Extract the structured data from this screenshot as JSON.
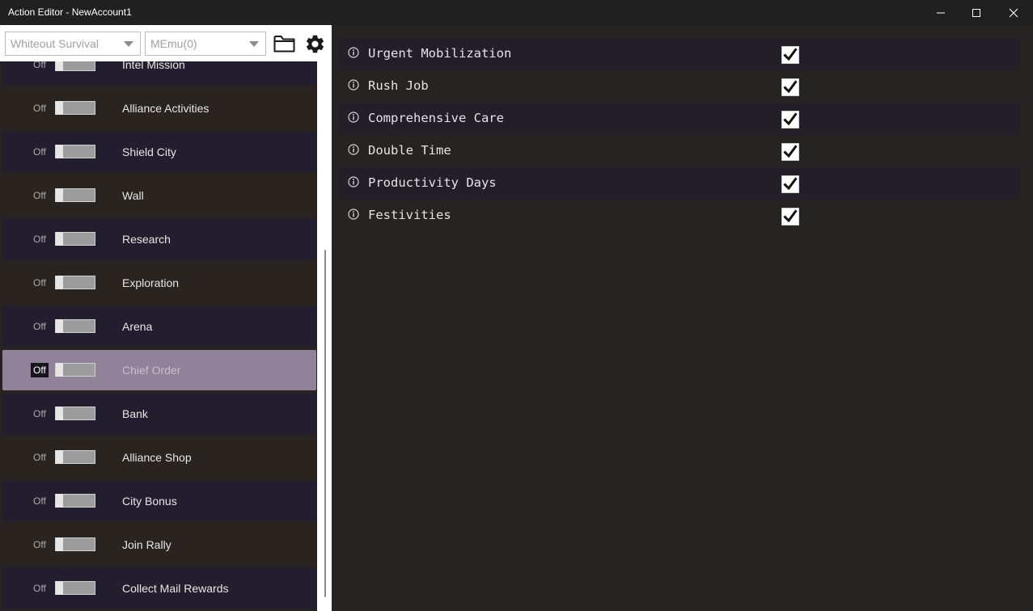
{
  "window": {
    "title": "Action Editor - NewAccount1",
    "controls": [
      "minimize-icon",
      "maximize-icon",
      "close-icon"
    ]
  },
  "toolbar": {
    "game_select": {
      "value": "Whiteout Survival"
    },
    "emulator_select": {
      "value": "MEmu(0)"
    },
    "icons": [
      "folder-icon",
      "gear-icon"
    ]
  },
  "actions": {
    "items": [
      {
        "label": "Intel Mission",
        "state": "Off",
        "selected": false
      },
      {
        "label": "Alliance Activities",
        "state": "Off",
        "selected": false
      },
      {
        "label": "Shield City",
        "state": "Off",
        "selected": false
      },
      {
        "label": "Wall",
        "state": "Off",
        "selected": false
      },
      {
        "label": "Research",
        "state": "Off",
        "selected": false
      },
      {
        "label": "Exploration",
        "state": "Off",
        "selected": false
      },
      {
        "label": "Arena",
        "state": "Off",
        "selected": false
      },
      {
        "label": "Chief Order",
        "state": "Off",
        "selected": true
      },
      {
        "label": "Bank",
        "state": "Off",
        "selected": false
      },
      {
        "label": "Alliance Shop",
        "state": "Off",
        "selected": false
      },
      {
        "label": "City Bonus",
        "state": "Off",
        "selected": false
      },
      {
        "label": "Join Rally",
        "state": "Off",
        "selected": false
      },
      {
        "label": "Collect Mail Rewards",
        "state": "Off",
        "selected": false
      }
    ]
  },
  "options": {
    "items": [
      {
        "label": "Urgent Mobilization",
        "checked": true
      },
      {
        "label": "Rush Job",
        "checked": true
      },
      {
        "label": "Comprehensive Care",
        "checked": true
      },
      {
        "label": "Double Time",
        "checked": true
      },
      {
        "label": "Productivity Days",
        "checked": true
      },
      {
        "label": "Festivities",
        "checked": true
      }
    ]
  },
  "colors": {
    "background": "#272322",
    "row_odd": "#231e2f",
    "row_even": "#2a2421",
    "row_selected": "#8f8299"
  }
}
